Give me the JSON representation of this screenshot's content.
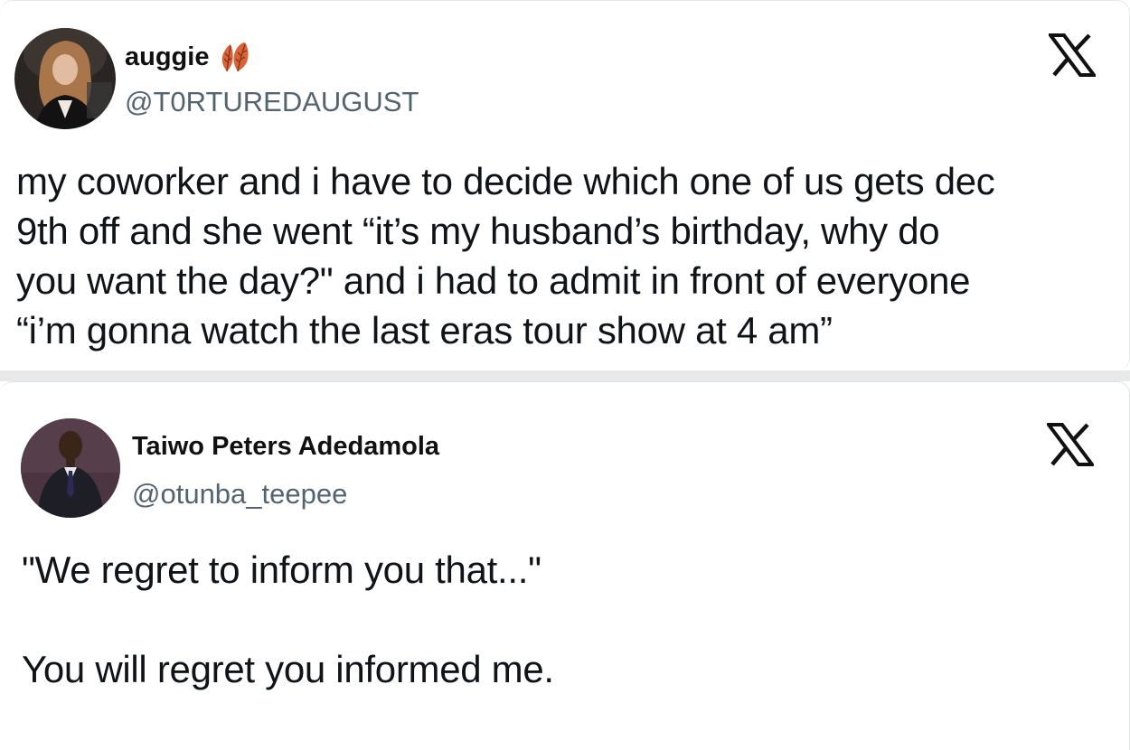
{
  "tweets": [
    {
      "display_name": "auggie",
      "name_emoji": "leaves-icon",
      "handle": "@T0RTUREDAUGUST",
      "lines": [
        "my coworker and i have to decide which one of us gets dec",
        "9th off and she went “it’s my husband’s birthday, why do",
        "you want the day?\" and i had to admit in front of everyone",
        "“i’m gonna watch the last eras tour show at 4 am”"
      ],
      "logo": "x-logo-icon"
    },
    {
      "display_name": "Taiwo Peters Adedamola",
      "handle": "@otunba_teepee",
      "lines": [
        "\"We regret to inform you that...\"",
        "",
        "You will regret you informed me."
      ],
      "logo": "x-logo-icon"
    }
  ],
  "colors": {
    "text": "#0f1419",
    "handle": "#536471",
    "separator": "#e8e9ea",
    "leaf": "#d9643a"
  }
}
